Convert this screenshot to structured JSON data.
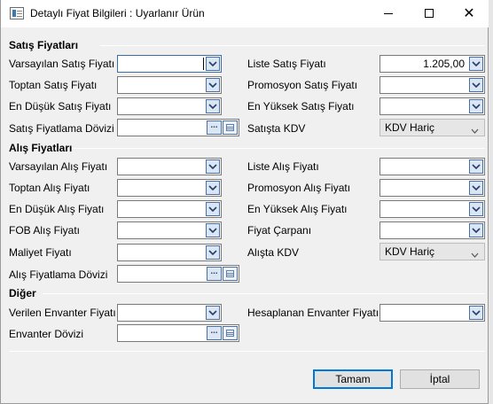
{
  "window": {
    "title": "Detaylı Fiyat Bilgileri : Uyarlanır Ürün",
    "minimize_label": "—",
    "maximize_label": "☐",
    "close_label": "✕"
  },
  "sales": {
    "section_title": "Satış Fiyatları",
    "default_price_label": "Varsayılan Satış Fiyatı",
    "default_price_value": "",
    "wholesale_label": "Toptan Satış Fiyatı",
    "wholesale_value": "",
    "lowest_label": "En Düşük Satış Fiyatı",
    "lowest_value": "",
    "currency_label": "Satış Fiyatlama Dövizi",
    "currency_value": "",
    "list_price_label": "Liste Satış Fiyatı",
    "list_price_value": "1.205,00",
    "promo_label": "Promosyon Satış Fiyatı",
    "promo_value": "",
    "highest_label": "En Yüksek Satış Fiyatı",
    "highest_value": "",
    "vat_label": "Satışta KDV",
    "vat_value": "KDV Hariç"
  },
  "purchase": {
    "section_title": "Alış Fiyatları",
    "default_price_label": "Varsayılan Alış Fiyatı",
    "default_price_value": "",
    "wholesale_label": "Toptan Alış Fiyatı",
    "wholesale_value": "",
    "lowest_label": "En Düşük Alış Fiyatı",
    "lowest_value": "",
    "fob_label": "FOB Alış Fiyatı",
    "fob_value": "",
    "cost_label": "Maliyet Fiyatı",
    "cost_value": "",
    "currency_label": "Alış Fiyatlama Dövizi",
    "currency_value": "",
    "list_price_label": "Liste Alış Fiyatı",
    "list_price_value": "",
    "promo_label": "Promosyon Alış Fiyatı",
    "promo_value": "",
    "highest_label": "En Yüksek Alış Fiyatı",
    "highest_value": "",
    "multiplier_label": "Fiyat Çarpanı",
    "multiplier_value": "",
    "vat_label": "Alışta KDV",
    "vat_value": "KDV Hariç"
  },
  "other": {
    "section_title": "Diğer",
    "given_inventory_label": "Verilen Envanter Fiyatı",
    "given_inventory_value": "",
    "calculated_inventory_label": "Hesaplanan Envanter Fiyatı",
    "calculated_inventory_value": "",
    "inventory_currency_label": "Envanter Dövizi",
    "inventory_currency_value": ""
  },
  "buttons": {
    "ok_label": "Tamam",
    "cancel_label": "İptal",
    "lookup_label": "..."
  },
  "colors": {
    "accent": "#0078d7",
    "dropdown_button": "#dce6f2"
  }
}
